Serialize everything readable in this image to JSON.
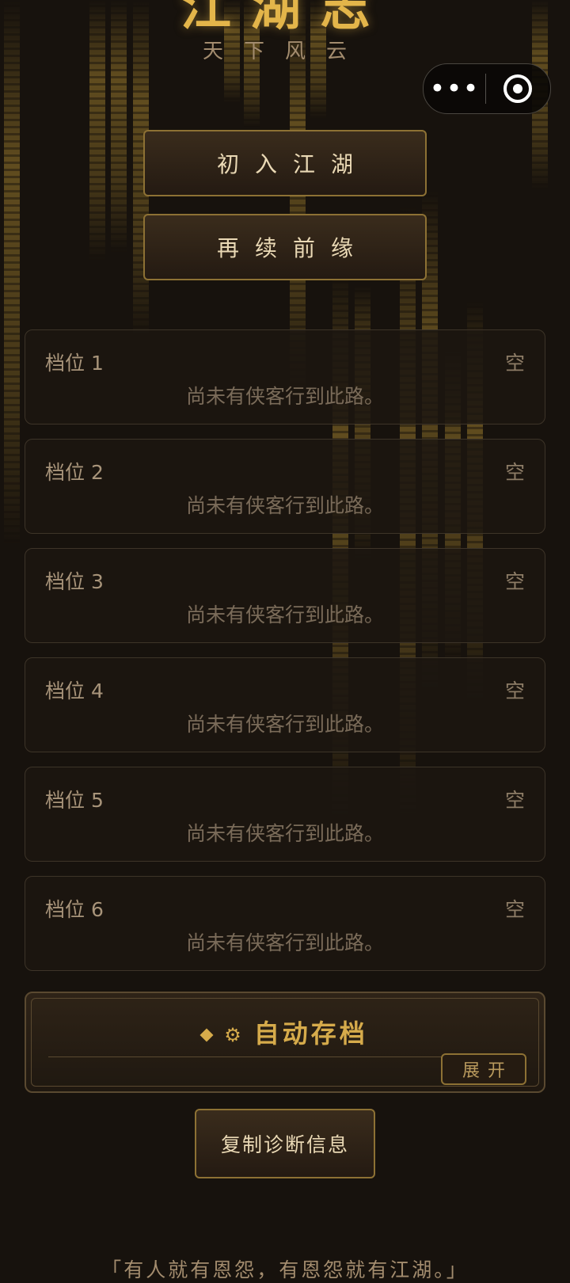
{
  "header": {
    "title": "江湖志",
    "subtitle": "天下风云"
  },
  "capsule": {
    "more_icon": "more-dots-icon",
    "close_icon": "target-circle-icon"
  },
  "actions": {
    "new_game_label": "初入江湖",
    "continue_label": "再续前缘"
  },
  "slots": [
    {
      "name": "档位 1",
      "status": "空",
      "desc": "尚未有侠客行到此路。"
    },
    {
      "name": "档位 2",
      "status": "空",
      "desc": "尚未有侠客行到此路。"
    },
    {
      "name": "档位 3",
      "status": "空",
      "desc": "尚未有侠客行到此路。"
    },
    {
      "name": "档位 4",
      "status": "空",
      "desc": "尚未有侠客行到此路。"
    },
    {
      "name": "档位 5",
      "status": "空",
      "desc": "尚未有侠客行到此路。"
    },
    {
      "name": "档位 6",
      "status": "空",
      "desc": "尚未有侠客行到此路。"
    }
  ],
  "autosave": {
    "title": "自动存档",
    "expand_label": "展开",
    "diamond_icon": "diamond-icon",
    "gear_icon": "gear-icon"
  },
  "diagnostics": {
    "copy_label": "复制诊断信息"
  },
  "footer": {
    "quote": "「有人就有恩怨，有恩怨就有江湖。」"
  },
  "colors": {
    "background": "#17120d",
    "gold": "#d6ab4b",
    "border_gold": "#8d7134"
  }
}
